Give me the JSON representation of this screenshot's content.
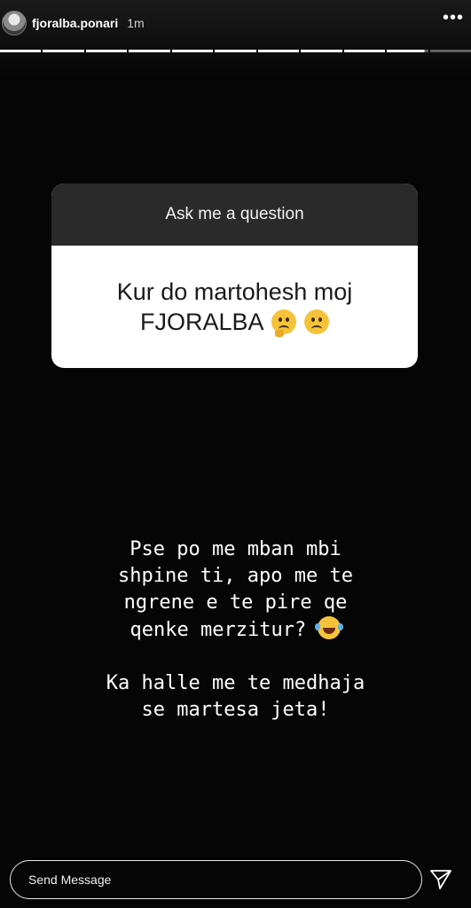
{
  "header": {
    "username": "fjoralba.ponari",
    "time": "1m",
    "more_icon": "more-horizontal-icon",
    "more_glyph": "•••"
  },
  "progress": {
    "segments": 11,
    "completed": 10
  },
  "question_sticker": {
    "title": "Ask me a question",
    "question": "Kur do martohesh moj FJORALBA",
    "emojis": [
      "thinking-face-emoji",
      "frowning-face-emoji"
    ]
  },
  "caption": {
    "line1": "Pse po me mban mbi",
    "line2": "shpine ti, apo me te",
    "line3": "ngrene e te pire qe",
    "line4": "qenke merzitur?",
    "emoji": "tears-of-joy-emoji",
    "line5": "Ka halle me te medhaja",
    "line6": "se martesa jeta!"
  },
  "footer": {
    "placeholder": "Send Message",
    "send_icon": "paper-plane-icon"
  },
  "colors": {
    "background": "#050505",
    "sticker_header": "#2a2a2a",
    "sticker_body": "#ffffff"
  }
}
